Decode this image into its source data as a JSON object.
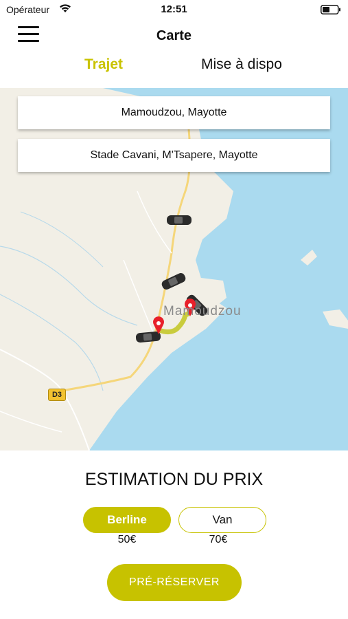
{
  "status_bar": {
    "carrier": "Opérateur",
    "time": "12:51"
  },
  "nav": {
    "title": "Carte"
  },
  "tabs": [
    {
      "label": "Trajet",
      "active": true
    },
    {
      "label": "Mise à dispo",
      "active": false
    }
  ],
  "map": {
    "from_address": "Mamoudzou, Mayotte",
    "to_address": "Stade Cavani, M'Tsapere, Mayotte",
    "city_label": "Mamoudzou",
    "road_badge": "D3"
  },
  "estimate": {
    "title": "ESTIMATION DU PRIX",
    "vehicles": [
      {
        "label": "Berline",
        "price": "50€",
        "selected": true
      },
      {
        "label": "Van",
        "price": "70€",
        "selected": false
      }
    ],
    "reserve_label": "PRÉ-RÉSERVER"
  },
  "colors": {
    "accent": "#c7c200",
    "map_land": "#f2efe6",
    "map_water": "#aadaef",
    "route": "#c4c82a",
    "pin": "#e8202a"
  }
}
